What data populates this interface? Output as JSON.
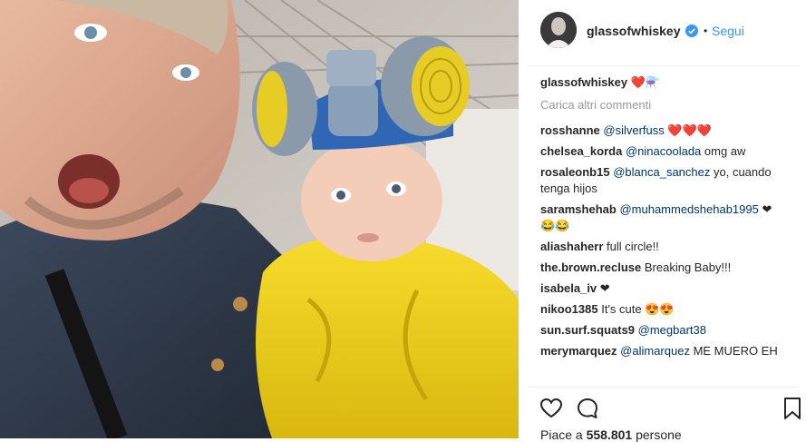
{
  "post": {
    "username": "glassofwhiskey",
    "verified_icon": "verified-badge-icon",
    "separator": "•",
    "follow_label": "Segui",
    "caption_user": "glassofwhiskey",
    "caption_text": "❤️⚗️",
    "load_more": "Carica altri commenti",
    "likes_prefix": "Piace a ",
    "likes_count": "558.801",
    "likes_suffix": " persone"
  },
  "comments": [
    {
      "user": "rosshanne",
      "mention": "@silverfuss",
      "text": " ❤️❤️❤️"
    },
    {
      "user": "chelsea_korda",
      "mention": "@ninacoolada",
      "text": " omg aw"
    },
    {
      "user": "rosaleonb15",
      "mention": "@blanca_sanchez",
      "text": " yo, cuando tenga hijos"
    },
    {
      "user": "saramshehab",
      "mention": "@muhammedshehab1995",
      "text": " ❤ 😂😂"
    },
    {
      "user": "aliashaherr",
      "mention": "",
      "text": "full circle!!"
    },
    {
      "user": "the.brown.recluse",
      "mention": "",
      "text": "Breaking Baby!!!"
    },
    {
      "user": "isabela_iv",
      "mention": "",
      "text": "❤"
    },
    {
      "user": "nikoo1385",
      "mention": "",
      "text": "It's cute 😍😍"
    },
    {
      "user": "sun.surf.squats9",
      "mention": "@megbart38",
      "text": ""
    },
    {
      "user": "merymarquez",
      "mention": "@alimarquez",
      "text": " ME MUERO EH"
    }
  ],
  "icons": {
    "like": "heart-icon",
    "comment": "comment-icon",
    "save": "bookmark-icon"
  },
  "colors": {
    "link": "#3897f0",
    "mention": "#003569",
    "muted": "#999999",
    "text": "#262626",
    "suit_yellow": "#f2d21a",
    "respirator_blue": "#4f86c6"
  }
}
